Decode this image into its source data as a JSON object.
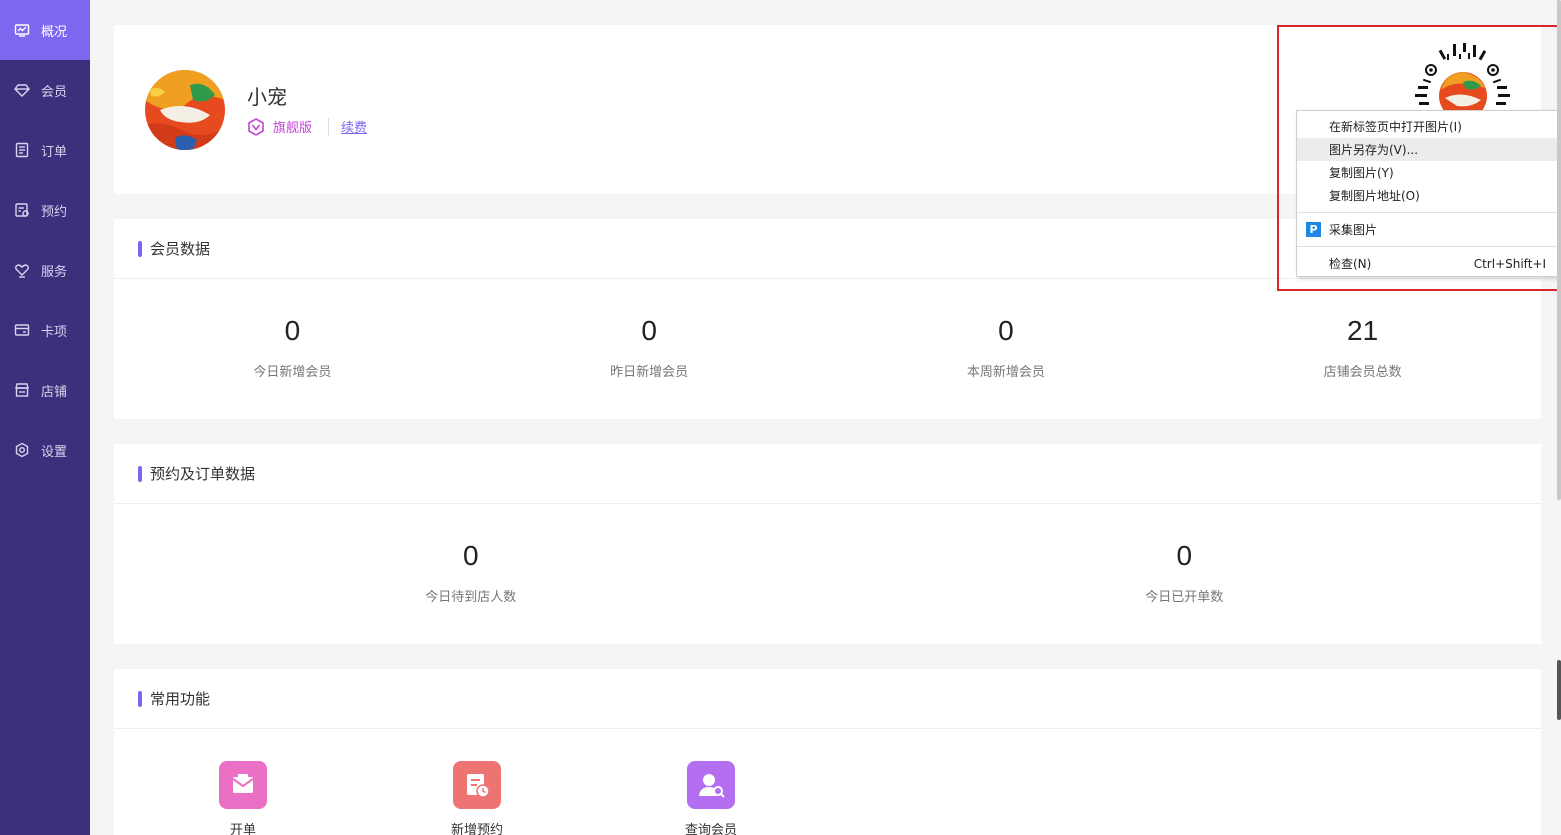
{
  "sidebar": {
    "items": [
      {
        "label": "概况",
        "icon": "monitor-icon",
        "active": true
      },
      {
        "label": "会员",
        "icon": "diamond-icon",
        "active": false
      },
      {
        "label": "订单",
        "icon": "list-icon",
        "active": false
      },
      {
        "label": "预约",
        "icon": "calendar-icon",
        "active": false
      },
      {
        "label": "服务",
        "icon": "hands-icon",
        "active": false
      },
      {
        "label": "卡项",
        "icon": "card-icon",
        "active": false
      },
      {
        "label": "店铺",
        "icon": "store-icon",
        "active": false
      },
      {
        "label": "设置",
        "icon": "gear-icon",
        "active": false
      }
    ]
  },
  "profile": {
    "shop_name": "小宠",
    "edition": "旗舰版",
    "renew": "续费"
  },
  "members": {
    "title": "会员数据",
    "stats": [
      {
        "value": "0",
        "label": "今日新增会员"
      },
      {
        "value": "0",
        "label": "昨日新增会员"
      },
      {
        "value": "0",
        "label": "本周新增会员"
      },
      {
        "value": "21",
        "label": "店铺会员总数"
      }
    ]
  },
  "booking": {
    "title": "预约及订单数据",
    "stats": [
      {
        "value": "0",
        "label": "今日待到店人数"
      },
      {
        "value": "0",
        "label": "今日已开单数"
      }
    ]
  },
  "common": {
    "title": "常用功能",
    "funcs": [
      {
        "label": "开单",
        "color": "#ec6fc6"
      },
      {
        "label": "新增预约",
        "color": "#ee7474"
      },
      {
        "label": "查询会员",
        "color": "#b46ef0"
      }
    ]
  },
  "context_menu": {
    "items": [
      {
        "label": "在新标签页中打开图片(I)"
      },
      {
        "label": "图片另存为(V)..."
      },
      {
        "label": "复制图片(Y)"
      },
      {
        "label": "复制图片地址(O)"
      },
      {
        "label": "采集图片",
        "icon_letter": "P"
      },
      {
        "label": "检查(N)",
        "shortcut": "Ctrl+Shift+I"
      }
    ]
  },
  "colors": {
    "sidebar_bg": "#3d2f7c",
    "accent": "#7b68ee",
    "highlight_box": "#d9262c"
  }
}
